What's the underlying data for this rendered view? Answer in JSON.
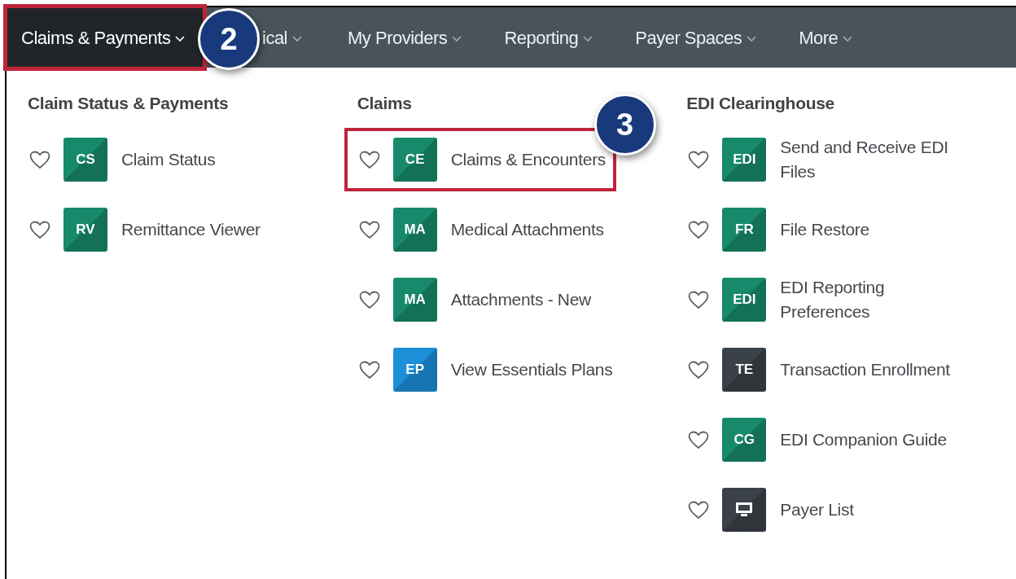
{
  "nav": [
    {
      "label": "Claims & Payments",
      "selected": true,
      "highlighted": true,
      "badge": "2"
    },
    {
      "label": "ical",
      "selected": false,
      "highlighted": false
    },
    {
      "label": "My Providers",
      "selected": false,
      "highlighted": false
    },
    {
      "label": "Reporting",
      "selected": false,
      "highlighted": false
    },
    {
      "label": "Payer Spaces",
      "selected": false,
      "highlighted": false
    },
    {
      "label": "More",
      "selected": false,
      "highlighted": false
    }
  ],
  "columns": [
    {
      "heading": "Claim Status & Payments",
      "items": [
        {
          "kind": "text",
          "tile": "CS",
          "color": "#178a6b",
          "label": "Claim Status",
          "highlighted": false
        },
        {
          "kind": "text",
          "tile": "RV",
          "color": "#178a6b",
          "label": "Remittance Viewer",
          "highlighted": false
        }
      ]
    },
    {
      "heading": "Claims",
      "items": [
        {
          "kind": "text",
          "tile": "CE",
          "color": "#178a6b",
          "label": "Claims & Encounters",
          "highlighted": true,
          "badge": "3"
        },
        {
          "kind": "text",
          "tile": "MA",
          "color": "#178a6b",
          "label": "Medical Attachments",
          "highlighted": false
        },
        {
          "kind": "text",
          "tile": "MA",
          "color": "#178a6b",
          "label": "Attachments - New",
          "highlighted": false
        },
        {
          "kind": "text",
          "tile": "EP",
          "color": "#1b8fd8",
          "label": "View Essentials Plans",
          "highlighted": false
        }
      ]
    },
    {
      "heading": "EDI Clearinghouse",
      "items": [
        {
          "kind": "text",
          "tile": "EDI",
          "color": "#178a6b",
          "label": "Send and Receive EDI Files",
          "highlighted": false
        },
        {
          "kind": "text",
          "tile": "FR",
          "color": "#178a6b",
          "label": "File Restore",
          "highlighted": false
        },
        {
          "kind": "text",
          "tile": "EDI",
          "color": "#178a6b",
          "label": "EDI Reporting Preferences",
          "highlighted": false
        },
        {
          "kind": "text",
          "tile": "TE",
          "color": "#3b4148",
          "label": "Transaction Enrollment",
          "highlighted": false
        },
        {
          "kind": "text",
          "tile": "CG",
          "color": "#178a6b",
          "label": "EDI Companion Guide",
          "highlighted": false
        },
        {
          "kind": "monitor",
          "color": "#3b4148",
          "label": "Payer List",
          "highlighted": false
        }
      ]
    }
  ]
}
